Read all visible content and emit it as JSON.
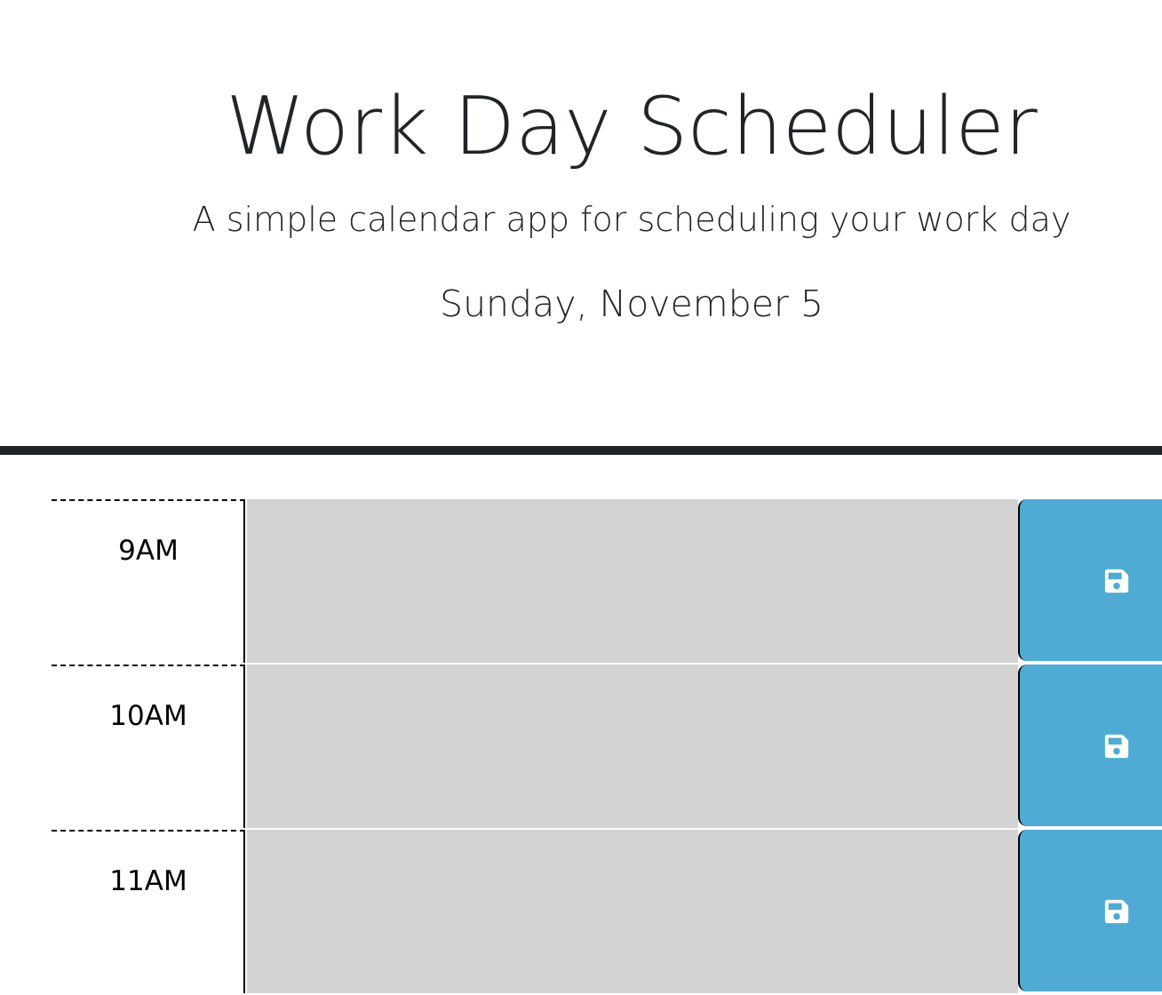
{
  "header": {
    "title": "Work Day Scheduler",
    "subtitle": "A simple calendar app for scheduling your work day",
    "current_day": "Sunday, November 5"
  },
  "colors": {
    "divider": "#212529",
    "past_block": "#d3d3d3",
    "save_button": "#4fabd4"
  },
  "time_blocks": [
    {
      "hour": "9AM",
      "description": "",
      "save_icon": "save-icon"
    },
    {
      "hour": "10AM",
      "description": "",
      "save_icon": "save-icon"
    },
    {
      "hour": "11AM",
      "description": "",
      "save_icon": "save-icon"
    }
  ]
}
